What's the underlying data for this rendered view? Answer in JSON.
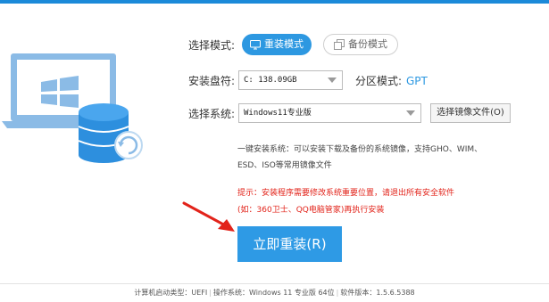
{
  "colors": {
    "accent": "#2d98e1",
    "warning": "#e2231a"
  },
  "mode": {
    "label": "选择模式:",
    "reinstall_label": "重装模式",
    "backup_label": "备份模式",
    "reinstall_icon": "monitor-icon",
    "backup_icon": "copy-icon"
  },
  "drive": {
    "label": "安装盘符:",
    "value": "C: 138.09GB"
  },
  "partition": {
    "label": "分区模式:",
    "value": "GPT"
  },
  "system": {
    "label": "选择系统:",
    "value": "Windows11专业版",
    "browse_label": "选择镜像文件(O)"
  },
  "info": {
    "line1": "一键安装系统：可以安装下载及备份的系统镜像，支持GHO、WIM、",
    "line2": "ESD、ISO等常用镜像文件"
  },
  "tip": {
    "line1": "提示：安装程序需要修改系统重要位置，请退出所有安全软件",
    "line2": "(如：360卫士、QQ电脑管家)再执行安装"
  },
  "action": {
    "reinstall_button": "立即重装(R)"
  },
  "footer": {
    "boot_type_label": "计算机启动类型：",
    "boot_type": "UEFI",
    "os_label": "操作系统：",
    "os": "Windows 11 专业版 64位",
    "version_label": "软件版本：",
    "version": "1.5.6.5388"
  }
}
